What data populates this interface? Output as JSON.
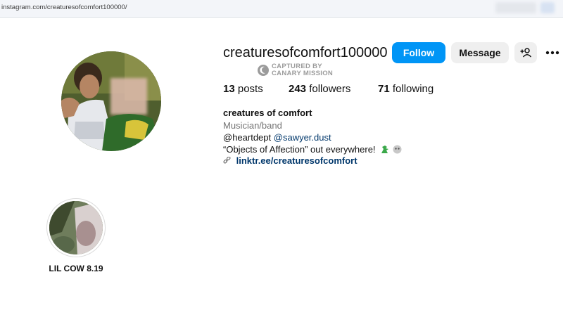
{
  "browser": {
    "url": "instagram.com/creaturesofcomfort100000/"
  },
  "profile": {
    "username": "creaturesofcomfort100000",
    "buttons": {
      "follow": "Follow",
      "message": "Message"
    },
    "watermark": {
      "line1": "CAPTURED BY",
      "line2": "CANARY MISSION"
    },
    "stats": {
      "posts_count": "13",
      "posts_label": "posts",
      "followers_count": "243",
      "followers_label": "followers",
      "following_count": "71",
      "following_label": "following"
    },
    "full_name": "creatures of comfort",
    "category": "Musician/band",
    "bio": {
      "mention1": "@heartdept",
      "mention2": "@sawyer.dust",
      "line2": "“Objects of Affection” out everywhere!"
    },
    "link": "linktr.ee/creaturesofcomfort"
  },
  "highlights": [
    {
      "label": "LIL COW 8.19"
    }
  ],
  "icons": {
    "add_user": "add-person-icon",
    "more": "more-options-icon",
    "link": "link-chain-icon",
    "dragon": "dragon-emoji-icon",
    "ghost": "ghost-emoji-icon"
  },
  "colors": {
    "accent": "#0095f6",
    "link": "#00376b",
    "secondary_text": "#737373"
  }
}
